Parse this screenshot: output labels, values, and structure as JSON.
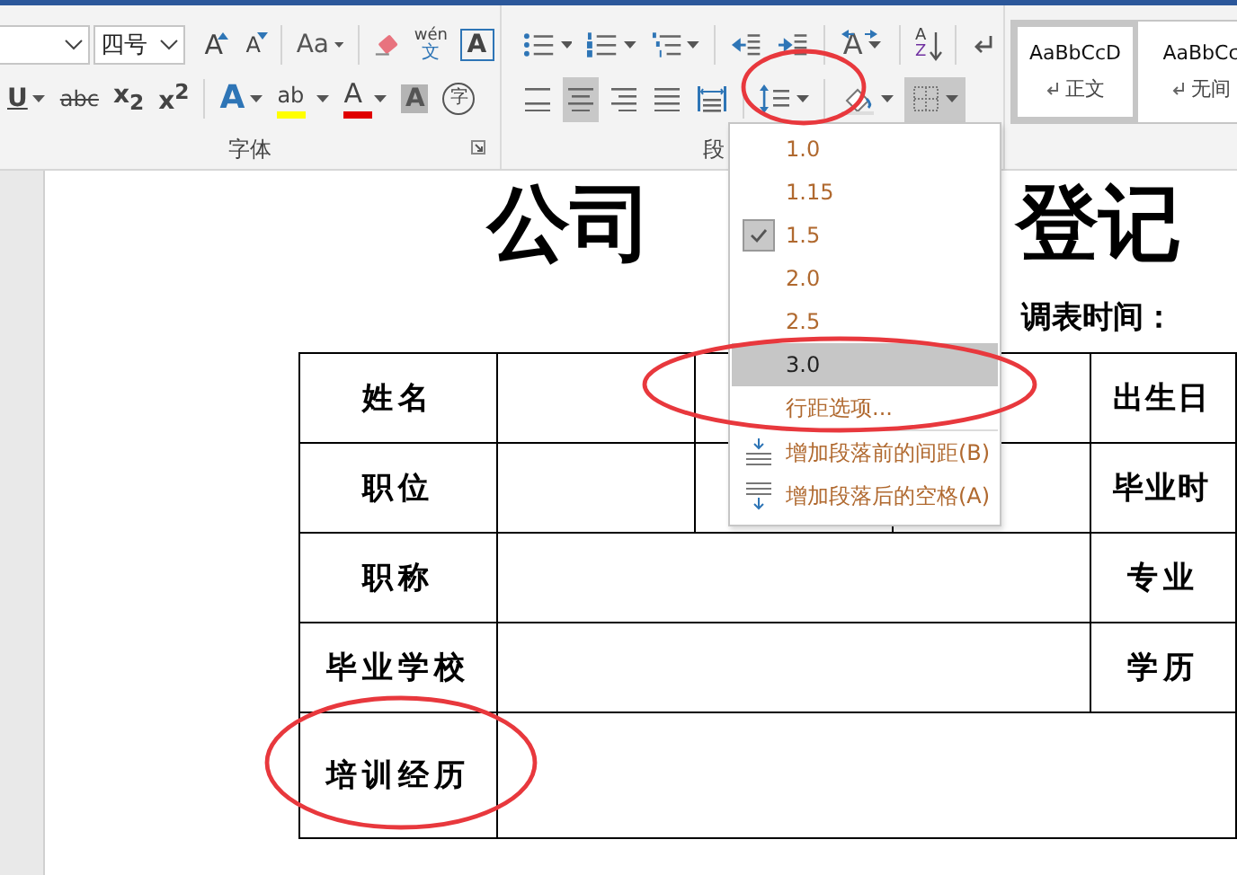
{
  "ribbon": {
    "font": {
      "size_value": "四号",
      "label": "字体",
      "row1": [
        {
          "kind": "grow",
          "text": "A",
          "caret": false
        },
        {
          "kind": "shrink",
          "text": "A",
          "caret": false
        },
        {
          "kind": "sep"
        },
        {
          "kind": "case",
          "text": "Aa",
          "caret": true
        },
        {
          "kind": "sep"
        },
        {
          "kind": "eraser",
          "caret": false
        },
        {
          "kind": "phonetic",
          "text": "wén",
          "sub": "文",
          "caret": false
        },
        {
          "kind": "boxed",
          "text": "A",
          "caret": false
        }
      ],
      "row2": [
        {
          "kind": "underline",
          "text": "U",
          "caret": true
        },
        {
          "kind": "strike",
          "text": "abc",
          "caret": false
        },
        {
          "kind": "subscript",
          "text": "x$_{2}$",
          "caret": false
        },
        {
          "kind": "superscript",
          "text": "x$^{2}$",
          "caret": false
        },
        {
          "kind": "sep"
        },
        {
          "kind": "effects",
          "text": "A",
          "caret": true
        },
        {
          "kind": "highlight",
          "text": "ab",
          "caret": true
        },
        {
          "kind": "fontcolor",
          "text": "A",
          "caret": true
        },
        {
          "kind": "shading",
          "text": "A",
          "caret": false
        },
        {
          "kind": "enclose",
          "text": "字",
          "caret": false
        }
      ]
    },
    "paragraph": {
      "label": "段",
      "row1": [
        {
          "kind": "bullets",
          "caret": true
        },
        {
          "kind": "numbering",
          "caret": true
        },
        {
          "kind": "multilevel",
          "caret": true
        },
        {
          "kind": "sep"
        },
        {
          "kind": "outdent",
          "caret": false
        },
        {
          "kind": "indent",
          "caret": false
        },
        {
          "kind": "sep"
        },
        {
          "kind": "asian",
          "text": "A",
          "caret": true
        },
        {
          "kind": "sep"
        },
        {
          "kind": "sort",
          "text": "A",
          "sub": "Z",
          "caret": false
        },
        {
          "kind": "sep"
        },
        {
          "kind": "marks",
          "caret": false
        }
      ],
      "row2": [
        {
          "kind": "align_left",
          "pressed": false,
          "circled": false,
          "caret": false
        },
        {
          "kind": "align_center",
          "pressed": true,
          "circled": false,
          "caret": false
        },
        {
          "kind": "align_right",
          "pressed": false,
          "circled": false,
          "caret": false
        },
        {
          "kind": "justify",
          "pressed": false,
          "circled": false,
          "caret": false
        },
        {
          "kind": "distributed",
          "pressed": false,
          "circled": false,
          "caret": false
        },
        {
          "kind": "sep"
        },
        {
          "kind": "line_spacing",
          "pressed": false,
          "circled": true,
          "caret": true
        },
        {
          "kind": "sep"
        },
        {
          "kind": "para_shading",
          "pressed": false,
          "circled": false,
          "caret": true
        },
        {
          "kind": "borders",
          "pressed": true,
          "circled": false,
          "caret": true
        }
      ]
    },
    "styles": [
      {
        "sample": "AaBbCcD",
        "name": "正文",
        "selected": true
      },
      {
        "sample": "AaBbCc",
        "name": "无间",
        "selected": false
      }
    ]
  },
  "line_spacing_menu": {
    "items": [
      {
        "kind": "value",
        "text": "1.0",
        "checked": false,
        "selected": false,
        "circled": false
      },
      {
        "kind": "value",
        "text": "1.15",
        "checked": false,
        "selected": false,
        "circled": false
      },
      {
        "kind": "value",
        "text": "1.5",
        "checked": true,
        "selected": false,
        "circled": false
      },
      {
        "kind": "value",
        "text": "2.0",
        "checked": false,
        "selected": false,
        "circled": false
      },
      {
        "kind": "value",
        "text": "2.5",
        "checked": false,
        "selected": false,
        "circled": false
      },
      {
        "kind": "value",
        "text": "3.0",
        "checked": false,
        "selected": true,
        "circled": true
      },
      {
        "kind": "option",
        "text": "行距选项...",
        "checked": false,
        "selected": false,
        "circled": false
      },
      {
        "kind": "space_before",
        "text": "增加段落前的间距(B)",
        "checked": false,
        "selected": false,
        "circled": false
      },
      {
        "kind": "space_after",
        "text": "增加段落后的空格(A)",
        "checked": false,
        "selected": false,
        "circled": false
      }
    ]
  },
  "document": {
    "title": [
      "公司",
      "登记"
    ],
    "date_label": "调表时间：",
    "table": {
      "rows": [
        {
          "cells": [
            {
              "kind": "label",
              "text": "姓名",
              "circled": false
            },
            {
              "kind": "blank"
            },
            {
              "kind": "blank"
            },
            {
              "kind": "blank"
            },
            {
              "kind": "edge",
              "text": "出生日",
              "circled": false
            }
          ]
        },
        {
          "cells": [
            {
              "kind": "label",
              "text": "职位",
              "circled": false
            },
            {
              "kind": "blank"
            },
            {
              "kind": "blank"
            },
            {
              "kind": "blank"
            },
            {
              "kind": "edge",
              "text": "毕业时",
              "circled": false
            }
          ]
        },
        {
          "cells": [
            {
              "kind": "label",
              "text": "职称",
              "circled": false
            },
            {
              "kind": "wide"
            },
            {
              "kind": "label",
              "text": "专业",
              "circled": false
            }
          ]
        },
        {
          "cells": [
            {
              "kind": "label",
              "text": "毕业学校",
              "circled": false
            },
            {
              "kind": "wide"
            },
            {
              "kind": "label",
              "text": "学历",
              "circled": false
            }
          ]
        },
        {
          "cells": [
            {
              "kind": "label",
              "text": "培训经历",
              "circled": true
            },
            {
              "kind": "rest"
            }
          ]
        }
      ]
    }
  }
}
